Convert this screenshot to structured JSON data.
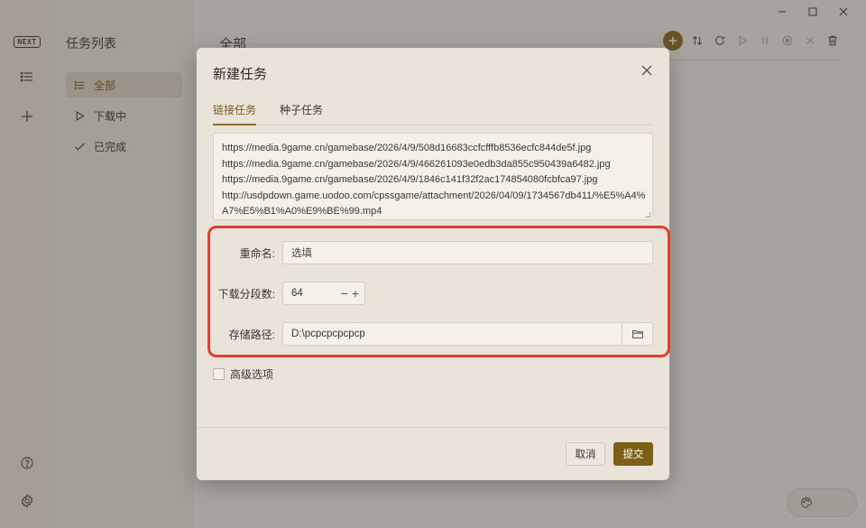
{
  "app": {
    "logo": "NEXT",
    "sidebar_title": "任务列表",
    "nav": [
      {
        "label": "全部",
        "active": true
      },
      {
        "label": "下载中",
        "active": false
      },
      {
        "label": "已完成",
        "active": false
      }
    ],
    "main_title": "全部",
    "accent_color": "#8a6a1c"
  },
  "dialog": {
    "title": "新建任务",
    "tabs": [
      {
        "label": "链接任务",
        "active": true
      },
      {
        "label": "种子任务",
        "active": false
      }
    ],
    "urls": [
      "https://media.9game.cn/gamebase/2026/4/9/508d16683ccfcfffb8536ecfc844de5f.jpg",
      "https://media.9game.cn/gamebase/2026/4/9/466261093e0edb3da855c950439a6482.jpg",
      "https://media.9game.cn/gamebase/2026/4/9/1846c141f32f2ac174854080fcbfca97.jpg",
      "http://usdpdown.game.uodoo.com/cpssgame/attachment/2026/04/09/1734567db411/%E5%A4%",
      "A7%E5%B1%A0%E9%BE%99.mp4"
    ],
    "rename": {
      "label": "重命名:",
      "placeholder": "选填"
    },
    "segments": {
      "label": "下载分段数:",
      "value": "64",
      "minus": "−",
      "plus": "+"
    },
    "path": {
      "label": "存储路径:",
      "value": "D:\\pcpcpcpcpcp"
    },
    "advanced_label": "高级选项",
    "cancel_label": "取消",
    "submit_label": "提交",
    "highlight_color": "#e0402a"
  }
}
